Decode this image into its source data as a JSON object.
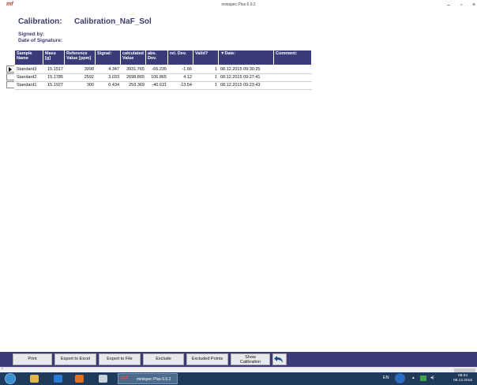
{
  "window": {
    "title": "minispec Plus 6.0.2",
    "app_logo": "mf",
    "controls": {
      "minimize": "–",
      "restore": "▫",
      "close": "×"
    }
  },
  "header": {
    "calibration_label": "Calibration:",
    "calibration_name": "Calibration_NaF_Sol",
    "signed_by_label": "Signed by:",
    "date_of_signature_label": "Date of Signature:"
  },
  "table": {
    "columns": [
      "Sample Name",
      "Mass [g]",
      "Reference Value [ppm]",
      "Signal:",
      "calculated Value",
      "abs. Dev.",
      "rel. Dev.",
      "Valid?",
      "▼Date:",
      "Comment:"
    ],
    "rows": [
      {
        "sample": "Standard3",
        "mass": "15.1517",
        "ref": "3998",
        "signal": "4.347",
        "calc": "3931.765",
        "abs": "-66.235",
        "rel": "-1.66",
        "valid": "1",
        "date": "08.12.2015 09:30:25",
        "comment": ""
      },
      {
        "sample": "Standard2",
        "mass": "15.1785",
        "ref": "2592",
        "signal": "3.033",
        "calc": "2698.865",
        "abs": "106.865",
        "rel": "4.12",
        "valid": "1",
        "date": "08.12.2015 09:27:41",
        "comment": ""
      },
      {
        "sample": "Standard1",
        "mass": "15.1927",
        "ref": "300",
        "signal": "0.434",
        "calc": "259.369",
        "abs": "-40.631",
        "rel": "-13.54",
        "valid": "1",
        "date": "08.12.2015 09:23:43",
        "comment": ""
      }
    ]
  },
  "toolbar": {
    "print": "Print",
    "export_excel": "Export to Excel",
    "export_file": "Export to File",
    "exclude": "Exclude",
    "excluded_points": "Excluded Points",
    "show_calibration_1": "Show",
    "show_calibration_2": "Calibration",
    "undo_icon": "undo-arrow"
  },
  "taskbar": {
    "task_label": "minispec Plus 6.0.2",
    "language": "EN",
    "time": "09:34",
    "date": "08.12.2015"
  },
  "colors": {
    "header_band": "#3b3b7a",
    "title_text": "#3b3b6e",
    "taskbar": "#1f3a5a"
  }
}
